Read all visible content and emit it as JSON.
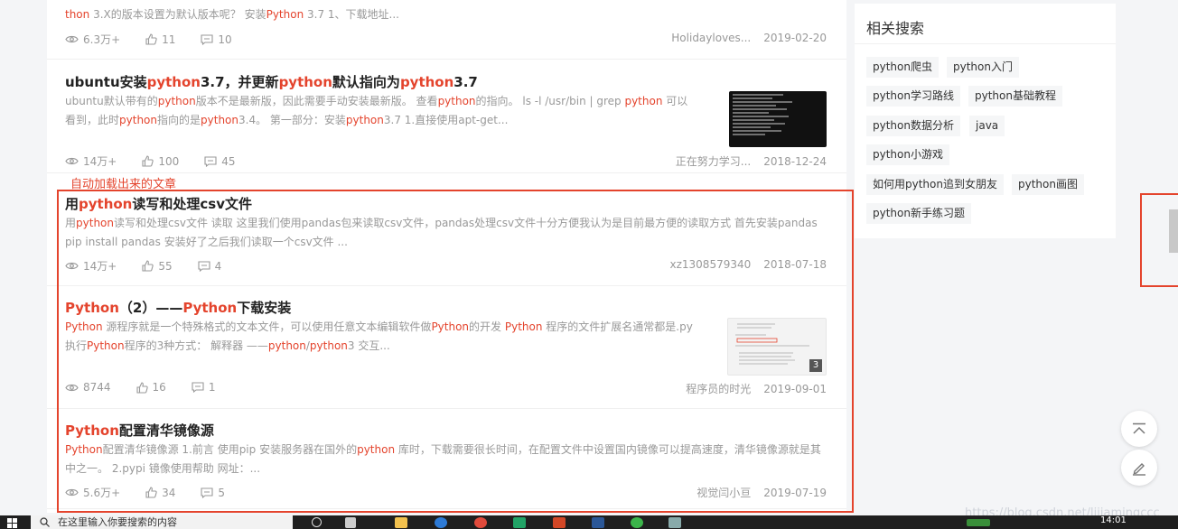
{
  "articles": [
    {
      "title_parts": [],
      "desc_parts": [
        {
          "t": "thon",
          "h": true
        },
        {
          "t": " 3.X的版本设置为默认版本呢？ 安装",
          "h": false
        },
        {
          "t": "Python",
          "h": true
        },
        {
          "t": " 3.7 1、下载地址...",
          "h": false
        }
      ],
      "views": "6.3万+",
      "likes": "11",
      "comments": "10",
      "author": "Holidayloves...",
      "date": "2019-02-20"
    },
    {
      "title_parts": [
        {
          "t": "ubuntu安装",
          "h": false
        },
        {
          "t": "python",
          "h": true
        },
        {
          "t": "3.7，并更新",
          "h": false
        },
        {
          "t": "python",
          "h": true
        },
        {
          "t": "默认指向为",
          "h": false
        },
        {
          "t": "python",
          "h": true
        },
        {
          "t": "3.7",
          "h": false
        }
      ],
      "desc_parts": [
        {
          "t": "ubuntu默认带有的",
          "h": false
        },
        {
          "t": "python",
          "h": true
        },
        {
          "t": "版本不是最新版，因此需要手动安装最新版。 查看",
          "h": false
        },
        {
          "t": "python",
          "h": true
        },
        {
          "t": "的指向。 ls -l /usr/bin | grep ",
          "h": false
        },
        {
          "t": "python",
          "h": true
        },
        {
          "t": " 可以看到，此时",
          "h": false
        },
        {
          "t": "python",
          "h": true
        },
        {
          "t": "指向的是",
          "h": false
        },
        {
          "t": "python",
          "h": true
        },
        {
          "t": "3.4。 第一部分：安装",
          "h": false
        },
        {
          "t": "python",
          "h": true
        },
        {
          "t": "3.7 1.直接使用apt-get...",
          "h": false
        }
      ],
      "views": "14万+",
      "likes": "100",
      "comments": "45",
      "author": "正在努力学习...",
      "date": "2018-12-24"
    },
    {
      "title_parts": [
        {
          "t": "用",
          "h": false
        },
        {
          "t": "python",
          "h": true
        },
        {
          "t": "读写和处理csv文件",
          "h": false
        }
      ],
      "desc_parts": [
        {
          "t": "用",
          "h": false
        },
        {
          "t": "python",
          "h": true
        },
        {
          "t": "读写和处理csv文件 读取 这里我们使用pandas包来读取csv文件，pandas处理csv文件十分方便我认为是目前最方便的读取方式 首先安装pandas pip install pandas 安装好了之后我们读取一个csv文件 ...",
          "h": false
        }
      ],
      "views": "14万+",
      "likes": "55",
      "comments": "4",
      "author": "xz1308579340",
      "date": "2018-07-18"
    },
    {
      "title_parts": [
        {
          "t": "Python",
          "h": true
        },
        {
          "t": "（2）——",
          "h": false
        },
        {
          "t": "Python",
          "h": true
        },
        {
          "t": "下载安装",
          "h": false
        }
      ],
      "desc_parts": [
        {
          "t": "Python",
          "h": true
        },
        {
          "t": " 源程序就是一个特殊格式的文本文件，可以使用任意文本编辑软件做",
          "h": false
        },
        {
          "t": "Python",
          "h": true
        },
        {
          "t": "的开发 ",
          "h": false
        },
        {
          "t": "Python",
          "h": true
        },
        {
          "t": " 程序的文件扩展名通常都是.py 执行",
          "h": false
        },
        {
          "t": "Python",
          "h": true
        },
        {
          "t": "程序的3种方式： 解释器 ——",
          "h": false
        },
        {
          "t": "python",
          "h": true
        },
        {
          "t": "/",
          "h": false
        },
        {
          "t": "python",
          "h": true
        },
        {
          "t": "3 交互...",
          "h": false
        }
      ],
      "views": "8744",
      "likes": "16",
      "comments": "1",
      "author": "程序员的时光",
      "date": "2019-09-01",
      "thumb_count": "3"
    },
    {
      "title_parts": [
        {
          "t": "Python",
          "h": true
        },
        {
          "t": "配置清华镜像源",
          "h": false
        }
      ],
      "desc_parts": [
        {
          "t": "Python",
          "h": true
        },
        {
          "t": "配置清华镜像源 1.前言 使用pip 安装服务器在国外的",
          "h": false
        },
        {
          "t": "python",
          "h": true
        },
        {
          "t": " 库时，下载需要很长时间，在配置文件中设置国内镜像可以提高速度，清华镜像源就是其中之一。 2.pypi 镜像使用帮助 网址：...",
          "h": false
        }
      ],
      "views": "5.6万+",
      "likes": "34",
      "comments": "5",
      "author": "视觉闫小亘",
      "date": "2019-07-19"
    }
  ],
  "annotation": "自动加载出来的文章",
  "sidebar": {
    "title": "相关搜索",
    "tags": [
      "python爬虫",
      "python入门",
      "python学习路线",
      "python基础教程",
      "python数据分析",
      "java",
      "python小游戏",
      "如何用python追到女朋友",
      "python画图",
      "python新手练习题"
    ]
  },
  "watermark": "https://blog.csdn.net/lijiamingccc",
  "taskbar": {
    "search_placeholder": "在这里输入你要搜索的内容",
    "time": "14:01"
  }
}
